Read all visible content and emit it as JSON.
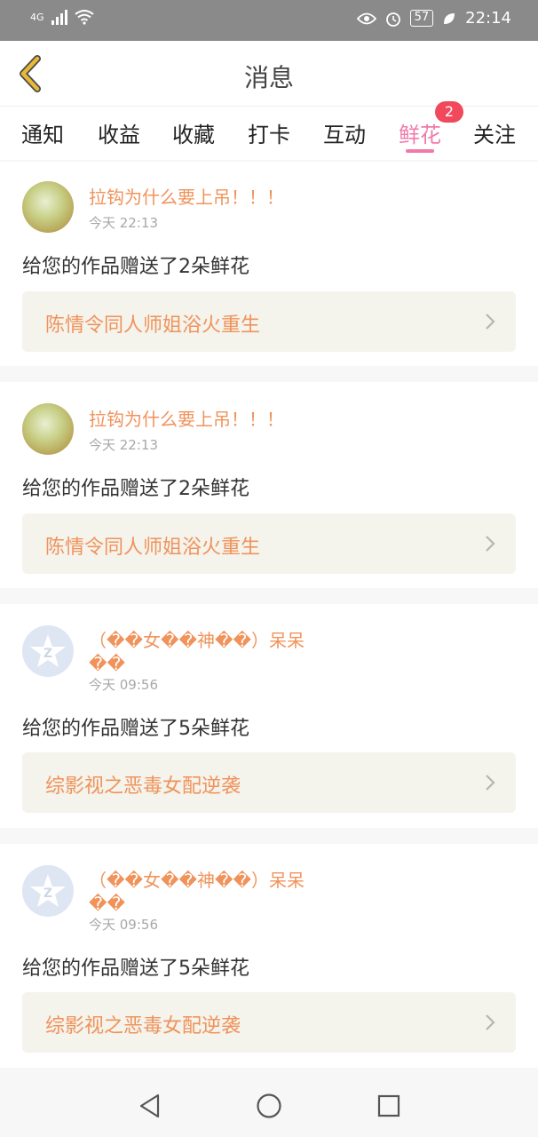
{
  "status_bar": {
    "network": "4G",
    "battery": "57",
    "time": "22:14",
    "icons": [
      "signal-icon",
      "wifi-icon",
      "eye-icon",
      "alarm-icon",
      "battery-icon",
      "leaf-icon"
    ]
  },
  "header": {
    "title": "消息",
    "back_icon": "chevron-left-icon"
  },
  "tabs": {
    "items": [
      "通知",
      "收益",
      "收藏",
      "打卡",
      "互动",
      "鲜花",
      "关注"
    ],
    "active": "鲜花",
    "badge": "2"
  },
  "messages": [
    {
      "avatar": "photo",
      "username": "拉钩为什么要上吊！！！",
      "time": "今天 22:13",
      "text": "给您的作品赠送了2朵鲜花",
      "work_title": "陈情令同人师姐浴火重生"
    },
    {
      "avatar": "photo",
      "username": "拉钩为什么要上吊！！！",
      "time": "今天 22:13",
      "text": "给您的作品赠送了2朵鲜花",
      "work_title": "陈情令同人师姐浴火重生"
    },
    {
      "avatar": "default",
      "username": "（��女��神��）呆呆��",
      "time": "今天 09:56",
      "text": "给您的作品赠送了5朵鲜花",
      "work_title": "综影视之恶毒女配逆袭"
    },
    {
      "avatar": "default",
      "username": "（��女��神��）呆呆��",
      "time": "今天 09:56",
      "text": "给您的作品赠送了5朵鲜花",
      "work_title": "综影视之恶毒女配逆袭"
    }
  ],
  "colors": {
    "accent_pink": "#f07aa9",
    "name_orange": "#f0935b",
    "badge_red": "#f1485b",
    "back_yellow": "#e8b838"
  },
  "nav_bar": {
    "icons": [
      "back-triangle-icon",
      "home-circle-icon",
      "recents-square-icon"
    ]
  }
}
